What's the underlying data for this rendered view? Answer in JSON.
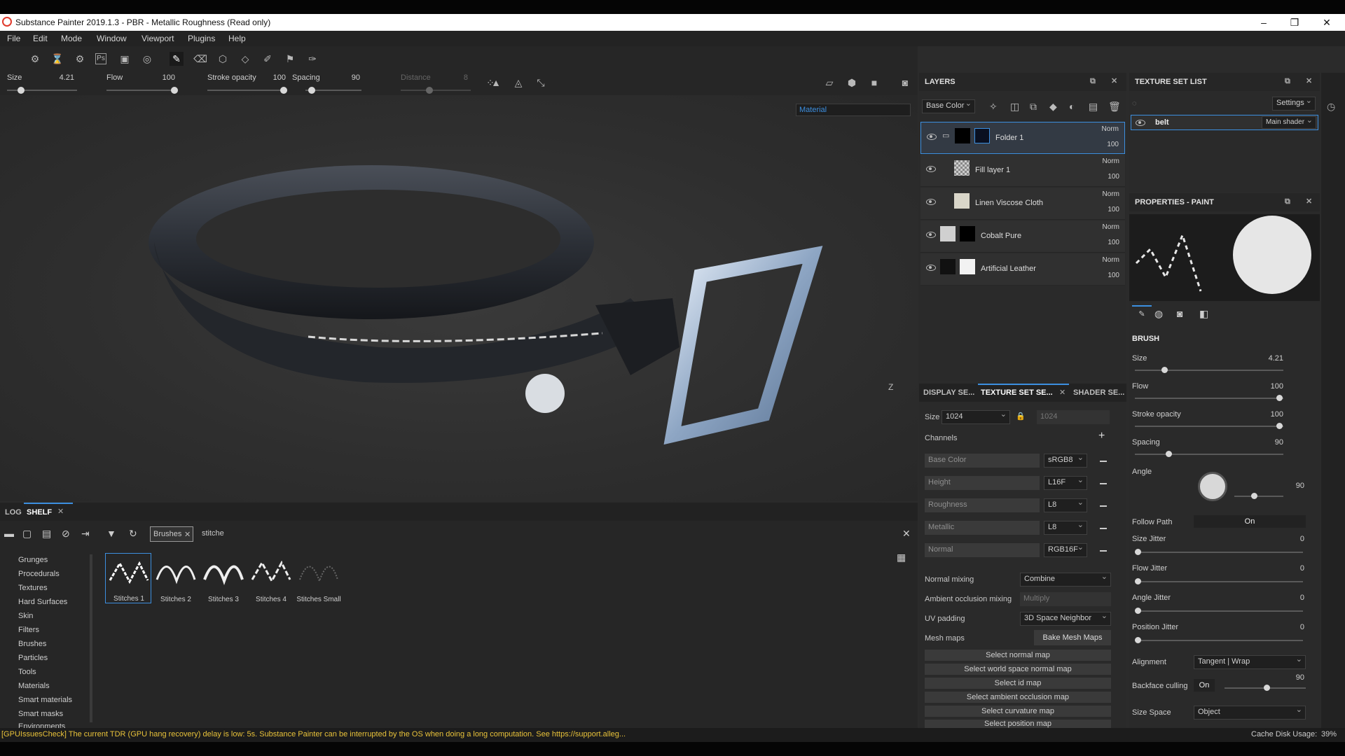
{
  "window": {
    "title": "Substance Painter 2019.1.3 - PBR - Metallic Roughness (Read only)",
    "controls": [
      "–",
      "❐",
      "✕"
    ]
  },
  "menu": [
    "File",
    "Edit",
    "Mode",
    "Window",
    "Viewport",
    "Plugins",
    "Help"
  ],
  "tool_params": {
    "size_label": "Size",
    "size_value": "4.21",
    "flow_label": "Flow",
    "flow_value": "100",
    "stroke_label": "Stroke opacity",
    "stroke_value": "100",
    "spacing_label": "Spacing",
    "spacing_value": "90",
    "distance_label": "Distance",
    "distance_value": "8"
  },
  "viewport": {
    "material_select": "Material",
    "gizmo_axis": "Z"
  },
  "layers": {
    "title": "LAYERS",
    "channel_select": "Base Color",
    "items": [
      {
        "name": "Folder 1",
        "blend": "Norm",
        "opacity": "100",
        "selected": true
      },
      {
        "name": "Fill layer 1",
        "blend": "Norm",
        "opacity": "100"
      },
      {
        "name": "Linen Viscose Cloth",
        "blend": "Norm",
        "opacity": "100"
      },
      {
        "name": "Cobalt Pure",
        "blend": "Norm",
        "opacity": "100"
      },
      {
        "name": "Artificial Leather",
        "blend": "Norm",
        "opacity": "100"
      }
    ]
  },
  "texture_set_list": {
    "title": "TEXTURE SET LIST",
    "settings_label": "Settings",
    "set_name": "belt",
    "shader": "Main shader"
  },
  "texture_set_settings": {
    "tabs": [
      "DISPLAY SE...",
      "TEXTURE SET SE...",
      "SHADER SE..."
    ],
    "size_label": "Size",
    "size_value": "1024",
    "size_value2": "1024",
    "channels_label": "Channels",
    "channels": [
      {
        "name": "Base Color",
        "format": "sRGB8"
      },
      {
        "name": "Height",
        "format": "L16F"
      },
      {
        "name": "Roughness",
        "format": "L8"
      },
      {
        "name": "Metallic",
        "format": "L8"
      },
      {
        "name": "Normal",
        "format": "RGB16F"
      }
    ],
    "normal_mixing_label": "Normal mixing",
    "normal_mixing_value": "Combine",
    "ao_mixing_label": "Ambient occlusion mixing",
    "ao_mixing_value": "Multiply",
    "uv_padding_label": "UV padding",
    "uv_padding_value": "3D Space Neighbor",
    "mesh_maps_label": "Mesh maps",
    "bake_button": "Bake Mesh Maps",
    "map_buttons": [
      "Select normal map",
      "Select world space normal map",
      "Select id map",
      "Select ambient occlusion map",
      "Select curvature map",
      "Select position map"
    ]
  },
  "properties": {
    "title": "PROPERTIES - PAINT",
    "section": "BRUSH",
    "size_label": "Size",
    "size_value": "4.21",
    "flow_label": "Flow",
    "flow_value": "100",
    "stroke_label": "Stroke opacity",
    "stroke_value": "100",
    "spacing_label": "Spacing",
    "spacing_value": "90",
    "angle_label": "Angle",
    "angle_value": "90",
    "follow_path_label": "Follow Path",
    "follow_path_value": "On",
    "size_jitter_label": "Size Jitter",
    "size_jitter_value": "0",
    "flow_jitter_label": "Flow Jitter",
    "flow_jitter_value": "0",
    "angle_jitter_label": "Angle Jitter",
    "angle_jitter_value": "0",
    "position_jitter_label": "Position Jitter",
    "position_jitter_value": "0",
    "alignment_label": "Alignment",
    "alignment_value": "Tangent | Wrap",
    "backface_label": "Backface culling",
    "backface_value": "On",
    "backface_num": "90",
    "size_space_label": "Size Space",
    "size_space_value": "Object"
  },
  "bottom": {
    "tabs": [
      "LOG",
      "SHELF"
    ],
    "filter_chip": "Brushes",
    "search_value": "stitche",
    "categories": [
      "Grunges",
      "Procedurals",
      "Textures",
      "Hard Surfaces",
      "Skin",
      "Filters",
      "Brushes",
      "Particles",
      "Tools",
      "Materials",
      "Smart materials",
      "Smart masks",
      "Environments"
    ],
    "brushes": [
      "Stitches 1",
      "Stitches 2",
      "Stitches 3",
      "Stitches 4",
      "Stitches Small"
    ]
  },
  "status": {
    "message": "[GPUIssuesCheck] The current TDR (GPU hang recovery) delay is low: 5s. Substance Painter can be interrupted by the OS when doing a long computation. See https://support.alleg...",
    "cache": "Cache Disk Usage:",
    "cache_value": "39%"
  }
}
